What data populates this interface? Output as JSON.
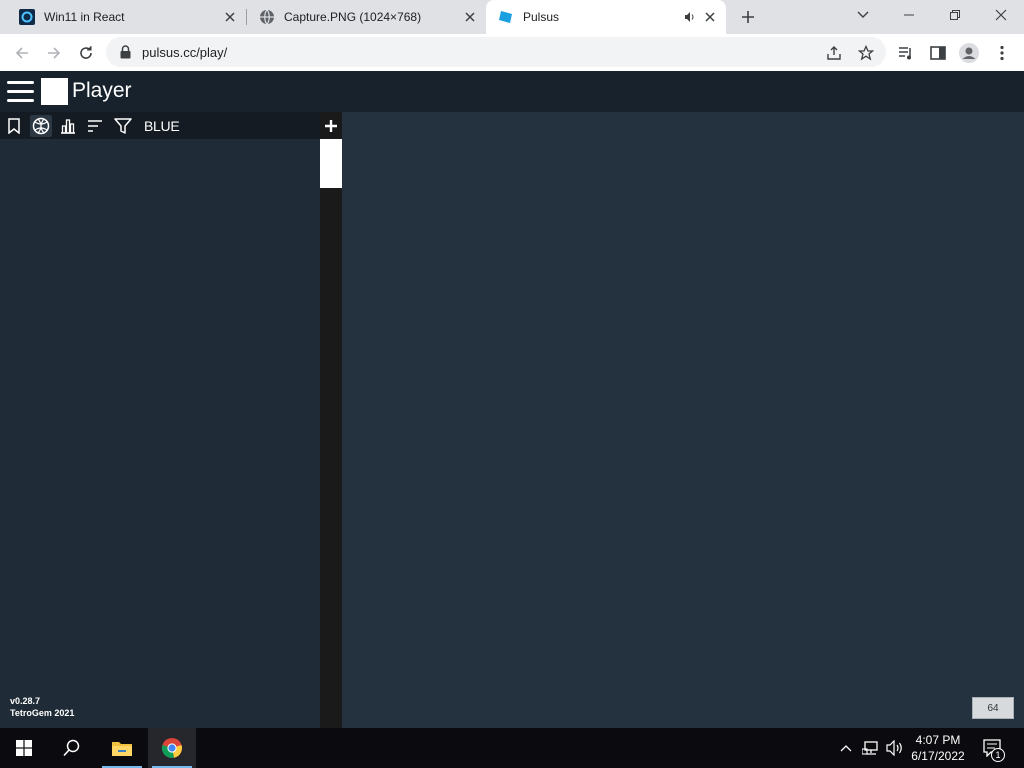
{
  "browser": {
    "tabs": [
      {
        "title": "Win11 in React",
        "icon": "win11-icon",
        "active": false
      },
      {
        "title": "Capture.PNG (1024×768)",
        "icon": "globe-icon",
        "active": false
      },
      {
        "title": "Pulsus",
        "icon": "pulsus-icon",
        "active": true,
        "audio": true
      }
    ],
    "url": "pulsus.cc/play/"
  },
  "app": {
    "title": "Player",
    "filter_label": "BLUE",
    "version": "v0.28.7",
    "credit": "TetroGem 2021",
    "counter": "64",
    "colors": {
      "header": "#17222c",
      "panel": "#1f2b36",
      "main": "#243240"
    }
  },
  "taskbar": {
    "time": "4:07 PM",
    "date": "6/17/2022",
    "notification_count": "1"
  }
}
